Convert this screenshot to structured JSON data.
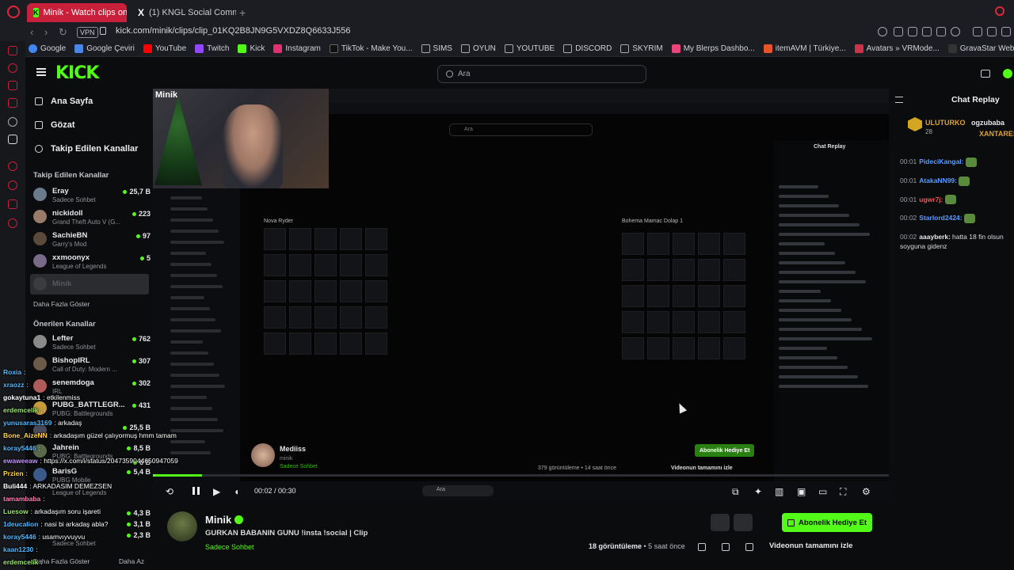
{
  "browser": {
    "tabs": [
      {
        "label": "Minik - Watch clips on",
        "active": true
      },
      {
        "label": "(1) KNGL Social Communi",
        "active": false
      }
    ],
    "url": "kick.com/minik/clips/clip_01KQ2B8JN9G5VXDZ8Q6633J556",
    "vpn": "VPN",
    "bookmarks": [
      "Google",
      "Google Çeviri",
      "YouTube",
      "Twitch",
      "Kick",
      "Instagram",
      "TikTok - Make You...",
      "SIMS",
      "OYUN",
      "YOUTUBE",
      "DISCORD",
      "SKYRIM",
      "My Blerps Dashbo...",
      "itemAVM | Türkiye...",
      "Avatars » VRMode...",
      "GravaStar Web-ba..."
    ]
  },
  "header": {
    "logo": "KICK",
    "search_placeholder": "Ara"
  },
  "sidebar": {
    "nav": [
      {
        "label": "Ana Sayfa",
        "icon": "home-icon"
      },
      {
        "label": "Gözat",
        "icon": "browse-icon"
      },
      {
        "label": "Takip Edilen Kanallar",
        "icon": "heart-icon"
      }
    ],
    "followed_title": "Takip Edilen Kanallar",
    "followed": [
      {
        "name": "Eray",
        "sub": "Sadece Sohbet",
        "viewers": "25,7 B"
      },
      {
        "name": "nickidoll",
        "sub": "Grand Theft Auto V (G...",
        "viewers": "223"
      },
      {
        "name": "SachieBN",
        "sub": "Garry's Mod",
        "viewers": "97"
      },
      {
        "name": "xxmoonyx",
        "sub": "League of Legends",
        "viewers": "5"
      },
      {
        "name": "Minik",
        "sub": "",
        "viewers": ""
      }
    ],
    "followed_more": "Daha Fazla Göster",
    "recommended_title": "Önerilen Kanallar",
    "recommended": [
      {
        "name": "Lefter",
        "sub": "Sadece Sohbet",
        "viewers": "762"
      },
      {
        "name": "BishopIRL",
        "sub": "Call of Duty: Modern ...",
        "viewers": "307"
      },
      {
        "name": "senemdoga",
        "sub": "IRL",
        "viewers": "302"
      },
      {
        "name": "PUBG_BATTLEGR...",
        "sub": "PUBG: Battlegrounds",
        "viewers": "431"
      },
      {
        "name": "",
        "sub": "",
        "viewers": "25,5 B"
      },
      {
        "name": "Jahrein",
        "sub": "PUBG: Battlegrounds",
        "viewers": "8,5 B"
      },
      {
        "name": "",
        "sub": "",
        "viewers": "6 B"
      },
      {
        "name": "BarisG",
        "sub": "PUBG Mobile",
        "viewers": "5,4 B"
      },
      {
        "name": "",
        "sub": "League of Legends",
        "viewers": ""
      },
      {
        "name": "",
        "sub": "",
        "viewers": "4,3 B"
      },
      {
        "name": "",
        "sub": "",
        "viewers": "3,1 B"
      },
      {
        "name": "",
        "sub": "",
        "viewers": "2,3 B"
      },
      {
        "name": "",
        "sub": "Sadece Sohbet",
        "viewers": ""
      }
    ],
    "more_show": "Daha Fazla Göster",
    "more_less": "Daha Az"
  },
  "overlay_chat": [
    {
      "user": "Roxia",
      "text": ":",
      "color": "#4fb8ff"
    },
    {
      "user": "xraozz",
      "text": ":",
      "color": "#4fb8ff"
    },
    {
      "user": "gokaytuna1",
      "text": ": etkilenmiss",
      "color": "#ffffff"
    },
    {
      "user": "erdemcelik",
      "text": ":",
      "color": "#9ae66e"
    },
    {
      "user": "yunusaras3169",
      "text": ": arkadaş",
      "color": "#4fb8ff"
    },
    {
      "user": "Bone_AizeNN",
      "text": ": arkadaşım güzel çalıyormuş hmm tamam",
      "color": "#ffd34f"
    },
    {
      "user": "koray5446",
      "text": ":",
      "color": "#4fb8ff"
    },
    {
      "user": "ewaweeaw",
      "text": ": https://x.com/i/status/2047359044650947059",
      "color": "#c594ff"
    },
    {
      "user": "Przien",
      "text": ":",
      "color": "#ffd34f"
    },
    {
      "user": "Buli444",
      "text": ": ARKADASIM DEMEZSEN",
      "color": "#ffffff"
    },
    {
      "user": "tamambaba",
      "text": ":",
      "color": "#ff7fb0"
    },
    {
      "user": "Luesow",
      "text": ": arkadaşım soru işareti",
      "color": "#9ae66e"
    },
    {
      "user": "1deucalion",
      "text": ": nasi bi arkadaş abla?",
      "color": "#4fb8ff"
    },
    {
      "user": "koray5446",
      "text": ": usamvıyvuyvu",
      "color": "#4fb8ff"
    },
    {
      "user": "kaan1230",
      "text": ":",
      "color": "#4fb8ff"
    },
    {
      "user": "erdemcelik",
      "text": ":",
      "color": "#9ae66e"
    }
  ],
  "stream_overlay": {
    "cam_logo": "Minik",
    "inner_search": "Ara",
    "inner_streamer_name": "Mediiss",
    "inner_streamer_sub": "minik",
    "inner_streamer_cat": "Sadece Sohbet",
    "inner_gift": "Abonelik Hediye Et",
    "inner_views": "379 görüntüleme • 14 saat önce",
    "inner_full": "Videonun tamamını izle",
    "inner_chat_title": "Chat Replay",
    "inv_left_title": "Nova Ryder",
    "inv_right_title": "Bohema Mamac Dolap 1"
  },
  "player": {
    "time": "00:02 / 00:30",
    "progress": 0.067,
    "taskbar_search": "Ara"
  },
  "clip": {
    "channel": "Minik",
    "title": "GURKAN BABANIN GUNU !insta !social | Clip",
    "category": "Sadece Sohbet",
    "views": "18 görüntüleme",
    "age": " • 5 saat önce",
    "gift_label": "Abonelik Hediye Et",
    "watch_full": "Videonun tamamını izle"
  },
  "chat_replay": {
    "title": "Chat Replay",
    "pinned_user": "ULUTURKO",
    "pinned_count": "28",
    "pinned_user2": "ogzubaba",
    "pinned_user3": "XANTARES",
    "messages": [
      {
        "time": "00:01",
        "user": "PideciKangal:",
        "text": "",
        "color": "#5b9bff"
      },
      {
        "time": "00:01",
        "user": "AtakaNN99:",
        "text": "",
        "color": "#5b9bff"
      },
      {
        "time": "00:01",
        "user": "ugwr7j:",
        "text": "",
        "color": "#e35b5b"
      },
      {
        "time": "00:02",
        "user": "Starlord2424:",
        "text": "",
        "color": "#5b9bff"
      },
      {
        "time": "00:02",
        "user": "aaayberk:",
        "text": "hatta 18 fin olsun soyguna gidenz",
        "color": "#e6e8eb"
      }
    ]
  }
}
